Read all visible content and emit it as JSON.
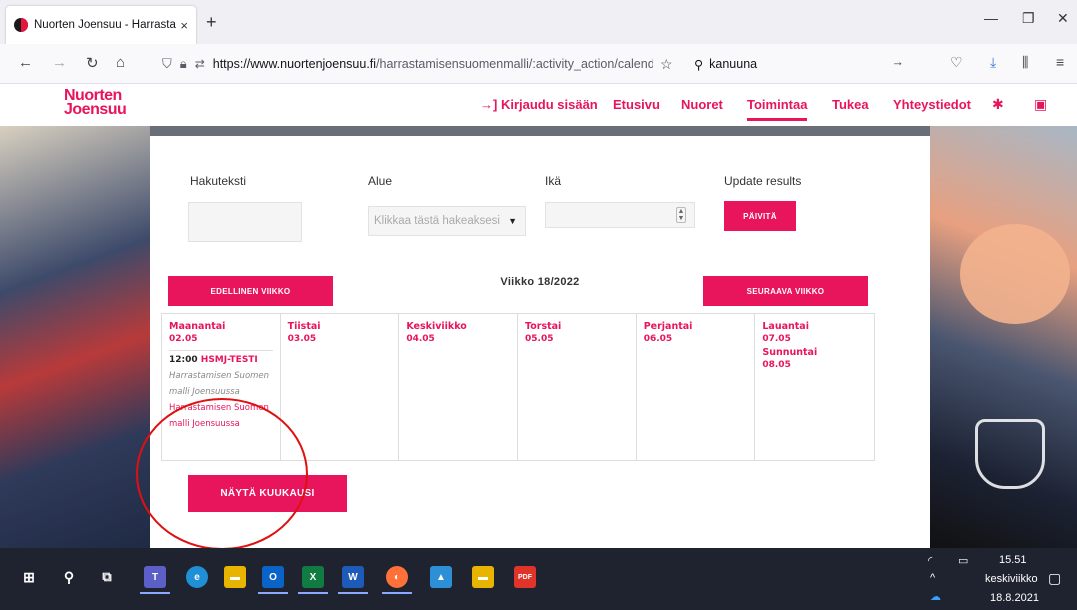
{
  "browser": {
    "tab_title": "Nuorten Joensuu - Harrastamis",
    "tab_close": "×",
    "new_tab": "+",
    "url_host": "https://www.nuortenjoensuu.fi",
    "url_path": "/harrastamisensuomenmalli/:activity_action/calendarvie",
    "search_value": "kanuuna",
    "win_min": "—",
    "win_restore": "❐",
    "win_close": "✕"
  },
  "site": {
    "logo_line1": "Nuorten",
    "logo_line2": "Joensuu",
    "menu": {
      "login": "→] Kirjaudu sisään",
      "home": "Etusivu",
      "youth": "Nuoret",
      "activities": "Toimintaa",
      "support": "Tukea",
      "contact": "Yhteystiedot"
    },
    "filters": {
      "search_label": "Hakuteksti",
      "area_label": "Alue",
      "area_placeholder": "Klikkaa tästä hakeaksesi",
      "age_label": "Ikä",
      "update_label": "Update results",
      "update_button": "PÄIVITÄ"
    },
    "prev_week": "EDELLINEN VIIKKO",
    "next_week": "SEURAAVA VIIKKO",
    "week_label": "Viikko 18/2022",
    "days": [
      {
        "name": "Maanantai",
        "date": "02.05"
      },
      {
        "name": "Tiistai",
        "date": "03.05"
      },
      {
        "name": "Keskiviikko",
        "date": "04.05"
      },
      {
        "name": "Torstai",
        "date": "05.05"
      },
      {
        "name": "Perjantai",
        "date": "06.05"
      },
      {
        "name": "Lauantai",
        "date": "07.05",
        "name2": "Sunnuntai",
        "date2": "08.05"
      }
    ],
    "event": {
      "time": "12:00",
      "title": "HSMJ-TESTI",
      "description": "Harrastamisen Suomen malli Joensuussa",
      "link": "Harrastamisen Suomen malli Joensuussa"
    },
    "month_button": "NÄYTÄ KUUKAUSI"
  },
  "taskbar": {
    "time": "15.51",
    "day": "keskiviikko",
    "date": "18.8.2021"
  },
  "colors": {
    "brand": "#e8145c",
    "annotation": "#e01010"
  }
}
